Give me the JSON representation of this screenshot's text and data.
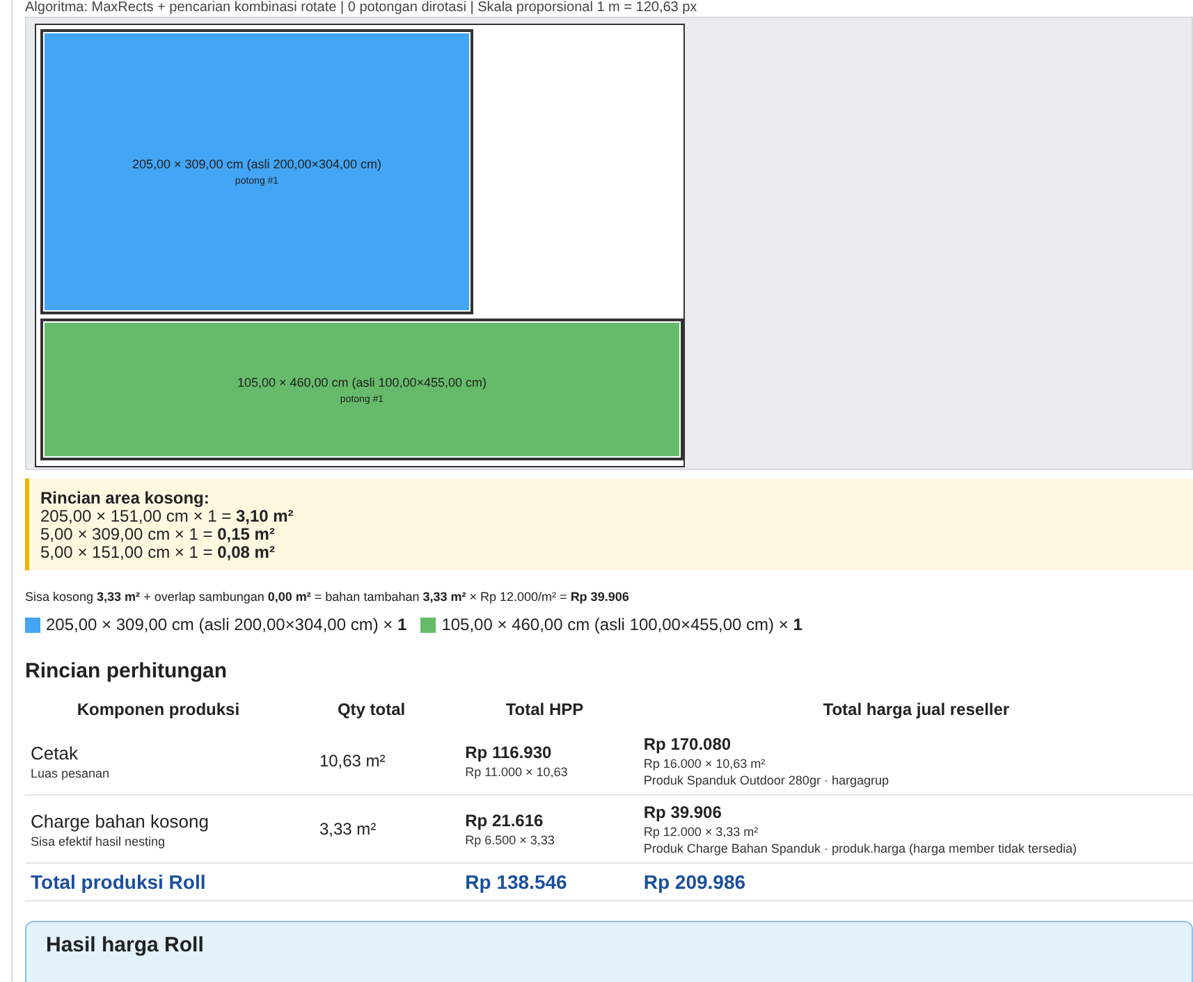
{
  "algorithm_line": "Algoritma: MaxRects + pencarian kombinasi rotate | 0 potongan dirotasi | Skala proporsional 1 m = 120,63 px",
  "pieces": [
    {
      "label": "205,00 × 309,00 cm (asli 200,00×304,00 cm)",
      "sub": "potong #1",
      "color": "#42a5f5"
    },
    {
      "label": "105,00 × 460,00 cm (asli 100,00×455,00 cm)",
      "sub": "potong #1",
      "color": "#66bb6a"
    }
  ],
  "empty_area": {
    "title": "Rincian area kosong:",
    "lines": [
      "205,00 × 151,00 cm × 1 = **3,10 m²**",
      "5,00 × 309,00 cm × 1 = **0,15 m²**",
      "5,00 × 151,00 cm × 1 = **0,08 m²**"
    ]
  },
  "summary": "Sisa kosong **3,33 m²** + overlap sambungan **0,00 m²** = bahan tambahan **3,33 m²** × Rp 12.000/m² = **Rp 39.906**",
  "legend": [
    {
      "text": "205,00 × 309,00 cm (asli 200,00×304,00 cm) × **1**",
      "color": "#42a5f5"
    },
    {
      "text": "105,00 × 460,00 cm (asli 100,00×455,00 cm) × **1**",
      "color": "#66bb6a"
    }
  ],
  "breakdown": {
    "title": "Rincian perhitungan",
    "columns": [
      "Komponen produksi",
      "Qty total",
      "Total HPP",
      "Total harga jual reseller"
    ],
    "rows": [
      {
        "name": "Cetak",
        "note": "Luas pesanan",
        "qty": "10,63 m²",
        "hpp": "Rp 116.930",
        "hpp_note": "Rp 11.000 × 10,63",
        "price": "Rp 170.080",
        "price_notes": [
          "Rp 16.000 × 10,63 m²",
          "Produk Spanduk Outdoor 280gr · hargagrup"
        ]
      },
      {
        "name": "Charge bahan kosong",
        "note": "Sisa efektif hasil nesting",
        "qty": "3,33 m²",
        "hpp": "Rp 21.616",
        "hpp_note": "Rp 6.500 × 3,33",
        "price": "Rp 39.906",
        "price_notes": [
          "Rp 12.000 × 3,33 m²",
          "Produk Charge Bahan Spanduk · produk.harga (harga member tidak tersedia)"
        ]
      }
    ],
    "total": {
      "label": "Total produksi Roll",
      "hpp": "Rp 138.546",
      "price": "Rp 209.986"
    }
  },
  "result_panel": {
    "title": "Hasil harga Roll"
  }
}
